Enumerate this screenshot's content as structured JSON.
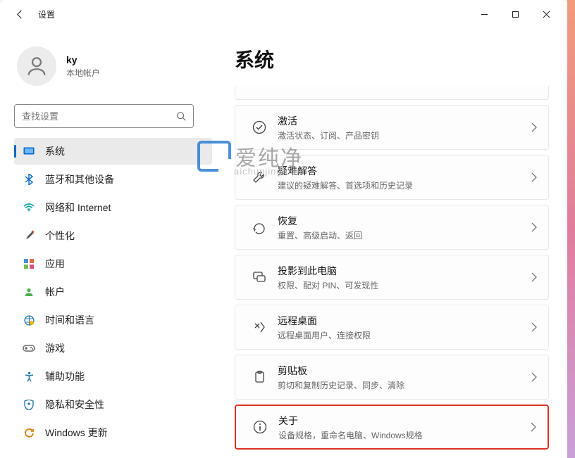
{
  "titlebar": {
    "title": "设置"
  },
  "profile": {
    "name": "ky",
    "subtitle": "本地帐户"
  },
  "search": {
    "placeholder": "查找设置"
  },
  "nav": {
    "items": [
      {
        "id": "system",
        "label": "系统"
      },
      {
        "id": "bluetooth",
        "label": "蓝牙和其他设备"
      },
      {
        "id": "network",
        "label": "网络和 Internet"
      },
      {
        "id": "personalization",
        "label": "个性化"
      },
      {
        "id": "apps",
        "label": "应用"
      },
      {
        "id": "accounts",
        "label": "帐户"
      },
      {
        "id": "time",
        "label": "时间和语言"
      },
      {
        "id": "gaming",
        "label": "游戏"
      },
      {
        "id": "accessibility",
        "label": "辅助功能"
      },
      {
        "id": "privacy",
        "label": "隐私和安全性"
      },
      {
        "id": "update",
        "label": "Windows 更新"
      }
    ]
  },
  "main": {
    "heading": "系统",
    "cards": [
      {
        "id": "activation",
        "title": "激活",
        "desc": "激活状态、订阅、产品密钥"
      },
      {
        "id": "troubleshoot",
        "title": "疑难解答",
        "desc": "建议的疑难解答、首选项和历史记录"
      },
      {
        "id": "recovery",
        "title": "恢复",
        "desc": "重置、高级启动、返回"
      },
      {
        "id": "project",
        "title": "投影到此电脑",
        "desc": "权限、配对 PIN、可发现性"
      },
      {
        "id": "remote",
        "title": "远程桌面",
        "desc": "远程桌面用户、连接权限"
      },
      {
        "id": "clipboard",
        "title": "剪贴板",
        "desc": "剪切和复制历史记录、同步、清除"
      },
      {
        "id": "about",
        "title": "关于",
        "desc": "设备规格，重命名电脑、Windows规格"
      }
    ]
  },
  "watermark": {
    "text": "爱纯净",
    "sub": "aichunjing.com"
  }
}
